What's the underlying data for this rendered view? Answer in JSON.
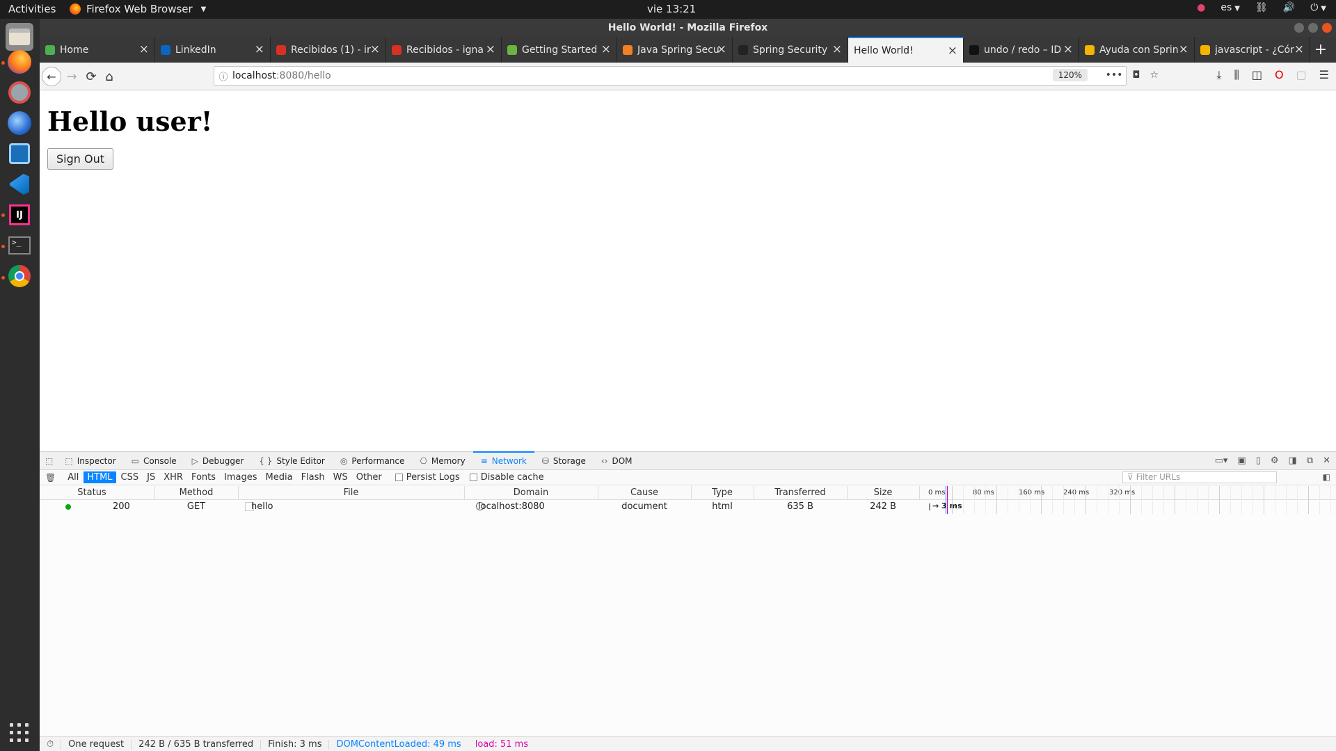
{
  "topbar": {
    "activities": "Activities",
    "app_name": "Firefox Web Browser",
    "clock": "vie 13:21",
    "language": "es"
  },
  "window": {
    "title": "Hello World! - Mozilla Firefox"
  },
  "tabs": [
    {
      "label": "Home",
      "favicon": "home-favicon",
      "color": "#4caf50"
    },
    {
      "label": "LinkedIn",
      "favicon": "linkedin-favicon",
      "color": "#0a66c2"
    },
    {
      "label": "Recibidos (1) - ir",
      "favicon": "gmail-favicon",
      "color": "#d93025"
    },
    {
      "label": "Recibidos - igna",
      "favicon": "gmail-favicon",
      "color": "#d93025"
    },
    {
      "label": "Getting Started",
      "favicon": "spring-favicon",
      "color": "#6db33f"
    },
    {
      "label": "Java Spring Secu",
      "favicon": "stackoverflow-favicon",
      "color": "#f48024"
    },
    {
      "label": "Spring Security",
      "favicon": "github-favicon",
      "color": "#222222"
    },
    {
      "label": "Hello World!",
      "favicon": "",
      "color": "#ffffff",
      "active": true
    },
    {
      "label": "undo / redo – ID",
      "favicon": "intellij-favicon",
      "color": "#111111"
    },
    {
      "label": "Ayuda con Sprin",
      "favicon": "stackexchange-favicon",
      "color": "#f4b400"
    },
    {
      "label": "javascript - ¿Cór",
      "favicon": "stackexchange-favicon",
      "color": "#f4b400"
    }
  ],
  "navbar": {
    "url_host": "localhost",
    "url_path": ":8080/hello",
    "zoom": "120%"
  },
  "page": {
    "heading": "Hello user!",
    "sign_out": "Sign Out"
  },
  "devtools": {
    "tabs": [
      "Inspector",
      "Console",
      "Debugger",
      "Style Editor",
      "Performance",
      "Memory",
      "Network",
      "Storage",
      "DOM"
    ],
    "active_tab": "Network",
    "filter_types": [
      "All",
      "HTML",
      "CSS",
      "JS",
      "XHR",
      "Fonts",
      "Images",
      "Media",
      "Flash",
      "WS",
      "Other"
    ],
    "active_filter": "HTML",
    "persist_logs": "Persist Logs",
    "disable_cache": "Disable cache",
    "filter_placeholder": "Filter URLs",
    "columns": [
      "Status",
      "Method",
      "File",
      "Domain",
      "Cause",
      "Type",
      "Transferred",
      "Size"
    ],
    "waterfall_ticks": [
      "0 ms",
      "80 ms",
      "160 ms",
      "240 ms",
      "320 ms"
    ],
    "requests": [
      {
        "status": "200",
        "method": "GET",
        "file": "hello",
        "domain": "localhost:8080",
        "cause": "document",
        "type": "html",
        "transferred": "635 B",
        "size": "242 B",
        "timing": "→ 3 ms"
      }
    ],
    "statusbar": {
      "requests": "One request",
      "transferred": "242 B / 635 B transferred",
      "finish": "Finish: 3 ms",
      "dcl": "DOMContentLoaded: 49 ms",
      "load": "load: 51 ms"
    }
  },
  "colors": {
    "accent": "#0a84ff",
    "ubuntu_orange": "#e95420",
    "status_ok": "#0ca70c",
    "load_pink": "#dd00a9"
  }
}
